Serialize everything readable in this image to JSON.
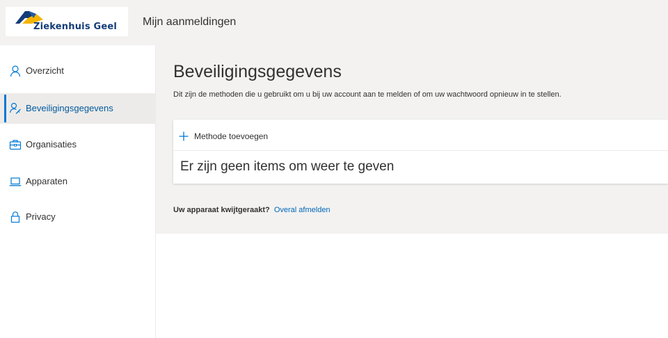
{
  "header": {
    "logo_text": "Ziekenhuis Geel",
    "title": "Mijn aanmeldingen"
  },
  "sidebar": {
    "items": [
      {
        "label": "Overzicht",
        "icon": "person-icon",
        "active": false
      },
      {
        "label": "Beveiligingsgegevens",
        "icon": "security-info-icon",
        "active": true
      },
      {
        "label": "Organisaties",
        "icon": "briefcase-icon",
        "active": false
      },
      {
        "label": "Apparaten",
        "icon": "laptop-icon",
        "active": false
      },
      {
        "label": "Privacy",
        "icon": "lock-icon",
        "active": false
      }
    ]
  },
  "main": {
    "title": "Beveiligingsgegevens",
    "subtitle": "Dit zijn de methoden die u gebruikt om u bij uw account aan te melden of om uw wachtwoord opnieuw in te stellen.",
    "add_method_label": "Methode toevoegen",
    "empty_message": "Er zijn geen items om weer te geven",
    "lost_device_question": "Uw apparaat kwijtgeraakt?",
    "sign_out_everywhere_link": "Overal afmelden"
  },
  "colors": {
    "accent": "#0078d4",
    "link": "#0067b8",
    "header_bg": "#f3f2f1",
    "logo_text": "#143c78",
    "logo_yellow": "#f5b400"
  }
}
